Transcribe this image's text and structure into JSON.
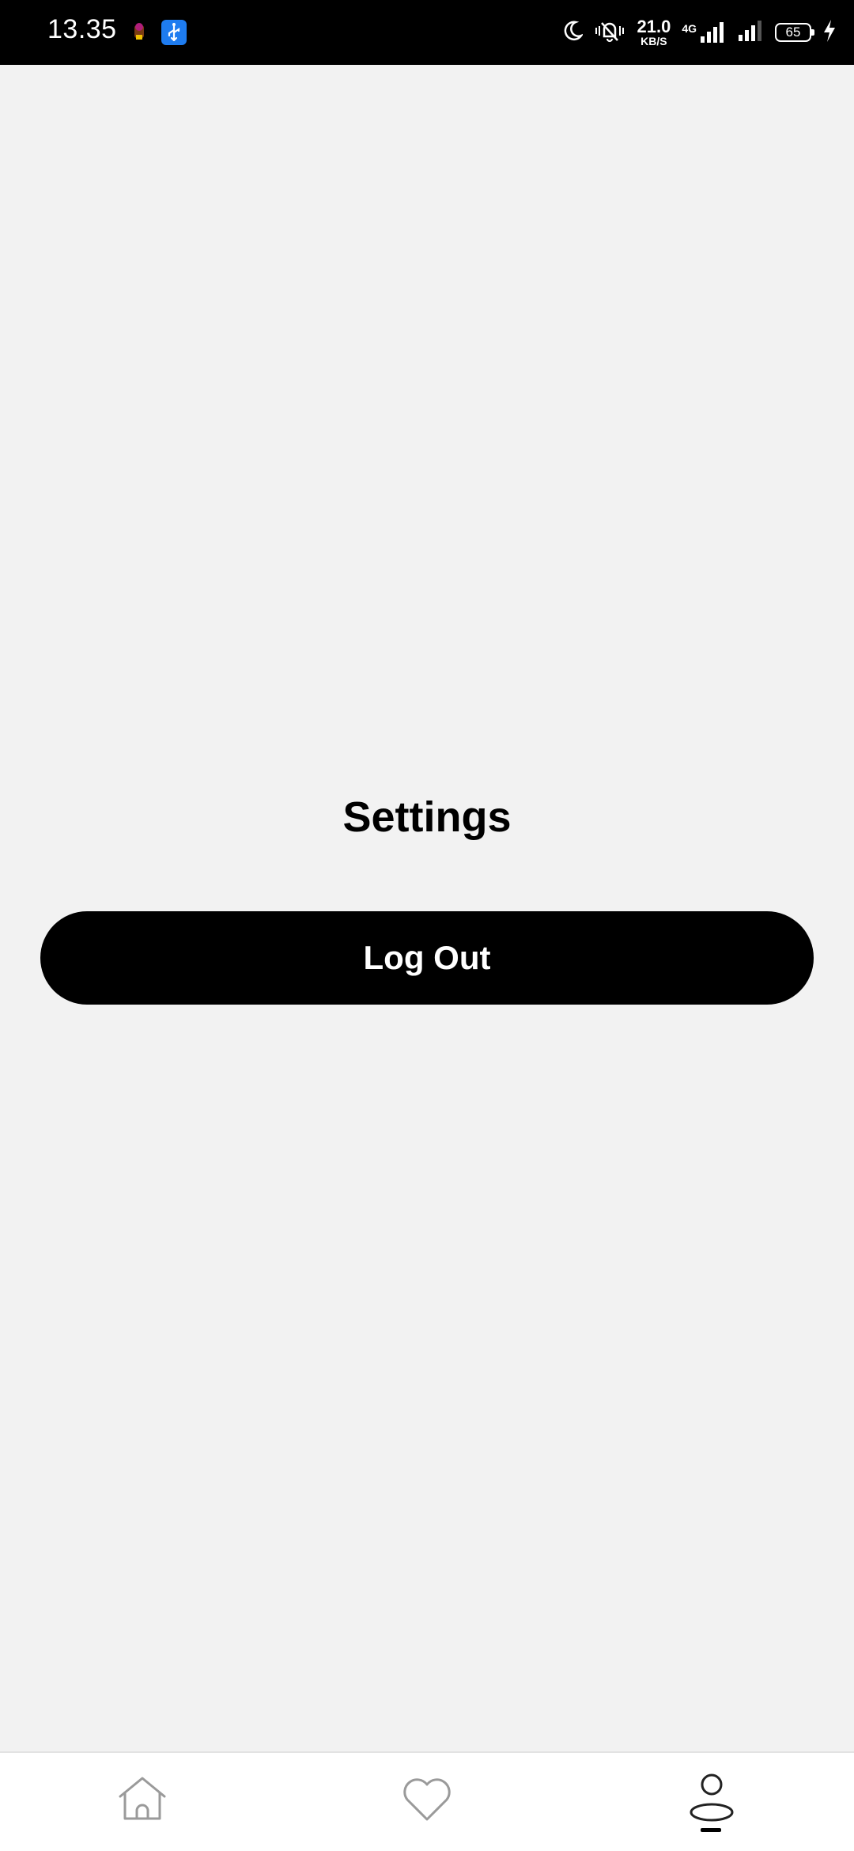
{
  "status_bar": {
    "time": "13.35",
    "net_speed_value": "21.0",
    "net_speed_unit": "KB/S",
    "network_type": "4G",
    "battery_level": "65",
    "icons": [
      "app-notification-icon",
      "usb-icon",
      "moon-icon",
      "vibrate-mute-icon",
      "signal-icon",
      "battery-icon",
      "charging-icon"
    ]
  },
  "page": {
    "title": "Settings",
    "logout_label": "Log Out"
  },
  "bottom_nav": {
    "items": [
      {
        "icon": "home-icon",
        "active": false
      },
      {
        "icon": "heart-icon",
        "active": false
      },
      {
        "icon": "profile-icon",
        "active": true
      }
    ]
  },
  "colors": {
    "background": "#f2f2f2",
    "primary": "#000000",
    "inactive_icon": "#9a9a9a"
  }
}
